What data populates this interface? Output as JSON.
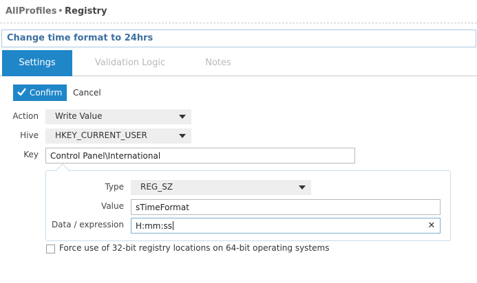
{
  "breadcrumb": {
    "root": "AllProfiles",
    "separator": "•",
    "current": "Registry"
  },
  "title": "Change time format to 24hrs",
  "tabs": [
    {
      "label": "Settings",
      "active": true
    },
    {
      "label": "Validation Logic",
      "active": false
    },
    {
      "label": "Notes",
      "active": false
    }
  ],
  "actions": {
    "confirm_label": "Confirm",
    "cancel_label": "Cancel"
  },
  "form": {
    "action": {
      "label": "Action",
      "value": "Write Value"
    },
    "hive": {
      "label": "Hive",
      "value": "HKEY_CURRENT_USER"
    },
    "key": {
      "label": "Key",
      "value": "Control Panel\\International"
    },
    "type": {
      "label": "Type",
      "value": "REG_SZ"
    },
    "value": {
      "label": "Value",
      "value": "sTimeFormat"
    },
    "data": {
      "label": "Data / expression",
      "value": "H:mm:ss"
    }
  },
  "checkbox": {
    "label": "Force use of 32-bit registry locations on 64-bit operating systems",
    "checked": false
  },
  "colors": {
    "accent": "#1f86c8",
    "title_text": "#3d6f9f",
    "tab_inactive": "#b9b9b9"
  },
  "icons": {
    "confirm": "checkmark-icon",
    "dropdown": "chevron-down-icon",
    "clear": "close-icon"
  }
}
